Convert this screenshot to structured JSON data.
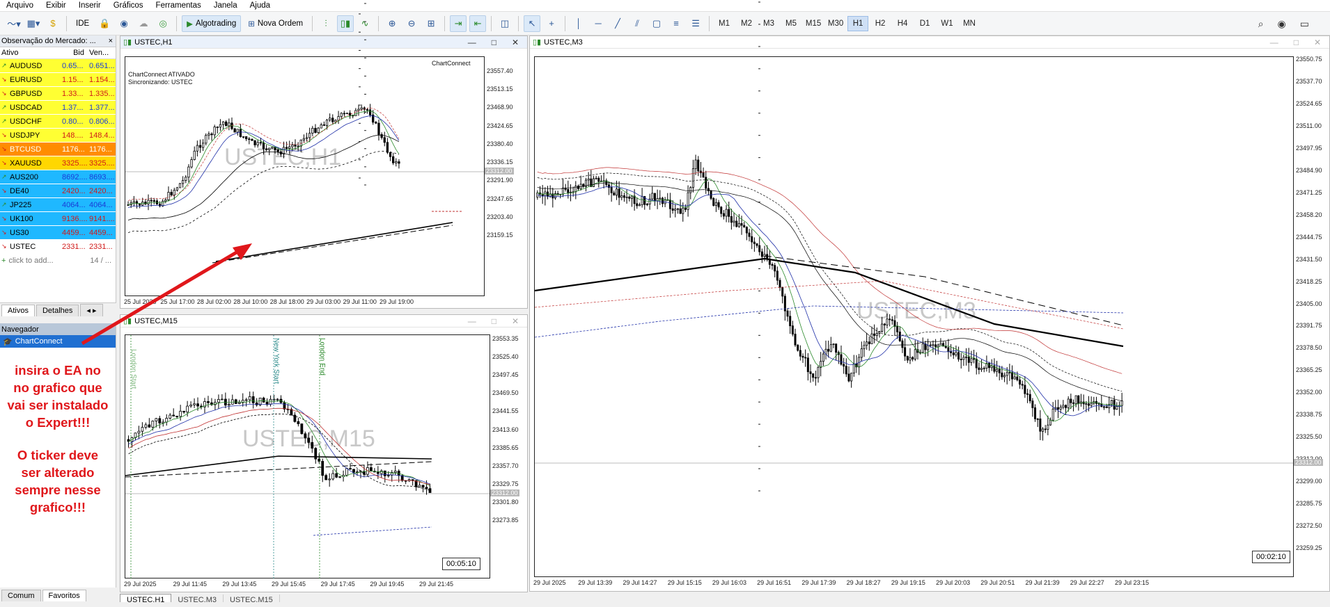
{
  "menu": [
    "Arquivo",
    "Exibir",
    "Inserir",
    "Gráficos",
    "Ferramentas",
    "Janela",
    "Ajuda"
  ],
  "toolbar": {
    "ide": "IDE",
    "algotrading": "Algotrading",
    "nova_ordem": "Nova Ordem",
    "timeframes": [
      "M1",
      "M2",
      "M3",
      "M5",
      "M15",
      "M30",
      "H1",
      "H2",
      "H4",
      "D1",
      "W1",
      "MN"
    ],
    "active_timeframe": "H1"
  },
  "market_watch": {
    "title": "Observação do Mercado: ...",
    "headers": [
      "Ativo",
      "Bid",
      "Ven..."
    ],
    "rows": [
      {
        "symbol": "AUDUSD",
        "bid": "0.65...",
        "ask": "0.651...",
        "dir": "up",
        "bg": "#ffff33"
      },
      {
        "symbol": "EURUSD",
        "bid": "1.15...",
        "ask": "1.154...",
        "dir": "down",
        "bg": "#ffff33"
      },
      {
        "symbol": "GBPUSD",
        "bid": "1.33...",
        "ask": "1.335...",
        "dir": "down",
        "bg": "#ffff33"
      },
      {
        "symbol": "USDCAD",
        "bid": "1.37...",
        "ask": "1.377...",
        "dir": "up",
        "bg": "#ffff33"
      },
      {
        "symbol": "USDCHF",
        "bid": "0.80...",
        "ask": "0.806...",
        "dir": "up",
        "bg": "#ffff33"
      },
      {
        "symbol": "USDJPY",
        "bid": "148....",
        "ask": "148.4...",
        "dir": "down",
        "bg": "#ffff33"
      },
      {
        "symbol": "BTCUSD",
        "bid": "1176...",
        "ask": "1176...",
        "dir": "down",
        "bg": "#ff8c00"
      },
      {
        "symbol": "XAUUSD",
        "bid": "3325....",
        "ask": "3325....",
        "dir": "down",
        "bg": "#ffd700"
      },
      {
        "symbol": "AUS200",
        "bid": "8692....",
        "ask": "8693....",
        "dir": "up",
        "bg": "#1fb8ff"
      },
      {
        "symbol": "DE40",
        "bid": "2420...",
        "ask": "2420...",
        "dir": "down",
        "bg": "#1fb8ff"
      },
      {
        "symbol": "JP225",
        "bid": "4064...",
        "ask": "4064...",
        "dir": "up",
        "bg": "#1fb8ff"
      },
      {
        "symbol": "UK100",
        "bid": "9136....",
        "ask": "9141....",
        "dir": "down",
        "bg": "#1fb8ff"
      },
      {
        "symbol": "US30",
        "bid": "4459...",
        "ask": "4459...",
        "dir": "down",
        "bg": "#1fb8ff"
      },
      {
        "symbol": "USTEC",
        "bid": "2331...",
        "ask": "2331...",
        "dir": "down",
        "bg": "#ffffff"
      }
    ],
    "add_label": "click to add...",
    "page": "14 / ...",
    "tabs": [
      "Ativos",
      "Detalhes"
    ]
  },
  "navigator": {
    "title": "Navegador",
    "item": "ChartConnect"
  },
  "annotation": {
    "line1": "insira o EA no",
    "line2": "no grafico que",
    "line3": "vai ser instalado",
    "line4": "o Expert!!!",
    "line5": "O ticker deve",
    "line6": "ser alterado",
    "line7": "sempre nesse",
    "line8": "grafico!!!"
  },
  "bottom_tabs": [
    "Comum",
    "Favoritos"
  ],
  "chart_h1": {
    "title": "USTEC,H1",
    "watermark": "USTEC,H1",
    "badge": "ChartConnect",
    "info_line1": "ChartConnect ATIVADO",
    "info_line2": "Sincronizando: USTEC",
    "prices": [
      "23557.40",
      "23513.15",
      "23468.90",
      "23424.65",
      "23380.40",
      "23336.15",
      "23291.90",
      "23247.65",
      "23203.40",
      "23159.15"
    ],
    "current_price": "23312.00",
    "times": [
      "25 Jul 2025",
      "25 Jul 17:00",
      "28 Jul 02:00",
      "28 Jul 10:00",
      "28 Jul 18:00",
      "29 Jul 03:00",
      "29 Jul 11:00",
      "29 Jul 19:00"
    ]
  },
  "chart_m15": {
    "title": "USTEC,M15",
    "watermark": "USTEC,M15",
    "session_ny": "New York Start",
    "session_london": "London End",
    "session_left": "London Start",
    "prices": [
      "23553.35",
      "23525.40",
      "23497.45",
      "23469.50",
      "23441.55",
      "23413.60",
      "23385.65",
      "23357.70",
      "23329.75",
      "23301.80",
      "23273.85"
    ],
    "current_price": "23312.00",
    "times": [
      "29 Jul 2025",
      "29 Jul 11:45",
      "29 Jul 13:45",
      "29 Jul 15:45",
      "29 Jul 17:45",
      "29 Jul 19:45",
      "29 Jul 21:45"
    ],
    "timer": "00:05:10"
  },
  "chart_m3": {
    "title": "USTEC,M3",
    "watermark": "USTEC,M3",
    "prices": [
      "23550.75",
      "23537.70",
      "23524.65",
      "23511.00",
      "23497.95",
      "23484.90",
      "23471.25",
      "23458.20",
      "23444.75",
      "23431.50",
      "23418.25",
      "23405.00",
      "23391.75",
      "23378.50",
      "23365.25",
      "23352.00",
      "23338.75",
      "23325.50",
      "23312.00",
      "23299.00",
      "23285.75",
      "23272.50",
      "23259.25"
    ],
    "current_price": "23312.00",
    "times": [
      "29 Jul 2025",
      "29 Jul 13:39",
      "29 Jul 14:27",
      "29 Jul 15:15",
      "29 Jul 16:03",
      "29 Jul 16:51",
      "29 Jul 17:39",
      "29 Jul 18:27",
      "29 Jul 19:15",
      "29 Jul 20:03",
      "29 Jul 20:51",
      "29 Jul 21:39",
      "29 Jul 22:27",
      "29 Jul 23:15"
    ],
    "timer": "00:02:10"
  },
  "window_tabs": [
    "USTEC,H1",
    "USTEC,M3",
    "USTEC,M15"
  ],
  "colors": {
    "annotation": "#e0171b",
    "selected": "#1f6fd1"
  }
}
